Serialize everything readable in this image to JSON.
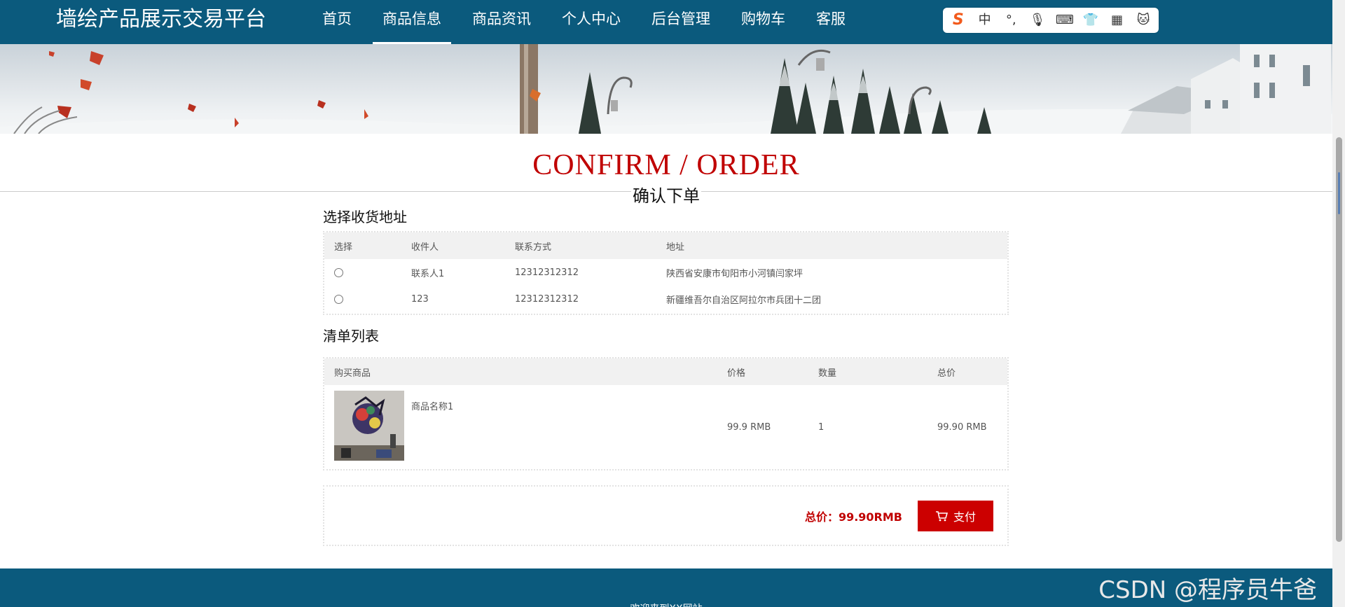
{
  "header": {
    "brand": "墙绘产品展示交易平台",
    "nav": [
      {
        "label": "首页"
      },
      {
        "label": "商品信息"
      },
      {
        "label": "商品资讯"
      },
      {
        "label": "个人中心"
      },
      {
        "label": "后台管理"
      },
      {
        "label": "购物车"
      },
      {
        "label": "客服"
      }
    ],
    "active_index": 1
  },
  "ime": {
    "items": [
      "S",
      "中",
      "°,",
      "🎙",
      "⌨",
      "👕",
      "▦",
      "🐱"
    ]
  },
  "page": {
    "title_en": "CONFIRM / ORDER",
    "title_cn": "确认下单"
  },
  "address": {
    "section_title": "选择收货地址",
    "headers": [
      "选择",
      "收件人",
      "联系方式",
      "地址"
    ],
    "rows": [
      {
        "name": "联系人1",
        "phone": "12312312312",
        "address": "陕西省安康市旬阳市小河镇闫家坪"
      },
      {
        "name": "123",
        "phone": "12312312312",
        "address": "新疆维吾尔自治区阿拉尔市兵团十二团"
      }
    ]
  },
  "orders": {
    "section_title": "清单列表",
    "headers": [
      "购买商品",
      "价格",
      "数量",
      "总价"
    ],
    "rows": [
      {
        "name": "商品名称1",
        "price": "99.9 RMB",
        "qty": "1",
        "total": "99.90 RMB"
      }
    ]
  },
  "payment": {
    "total_label": "总价：99.90RMB",
    "pay_label": "支付"
  },
  "footer": {
    "text": "欢迎来到XX网站"
  },
  "watermark": "CSDN @程序员牛爸",
  "colors": {
    "header_bg": "#0b5a7d",
    "accent_red": "#cc0000",
    "title_red": "#c00000"
  }
}
